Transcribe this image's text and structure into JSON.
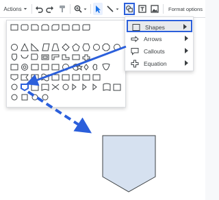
{
  "toolbar": {
    "actions_label": "Actions",
    "format_options_label": "Format options"
  },
  "submenu": {
    "items": [
      {
        "label": "Shapes",
        "icon": "shapes-icon"
      },
      {
        "label": "Arrows",
        "icon": "arrow-icon"
      },
      {
        "label": "Callouts",
        "icon": "callout-icon"
      },
      {
        "label": "Equation",
        "icon": "equation-icon"
      }
    ]
  },
  "colors": {
    "highlight": "#2b5fdb",
    "shape_fill": "#d6e1f0",
    "menu_selected": "#e8eaed"
  }
}
